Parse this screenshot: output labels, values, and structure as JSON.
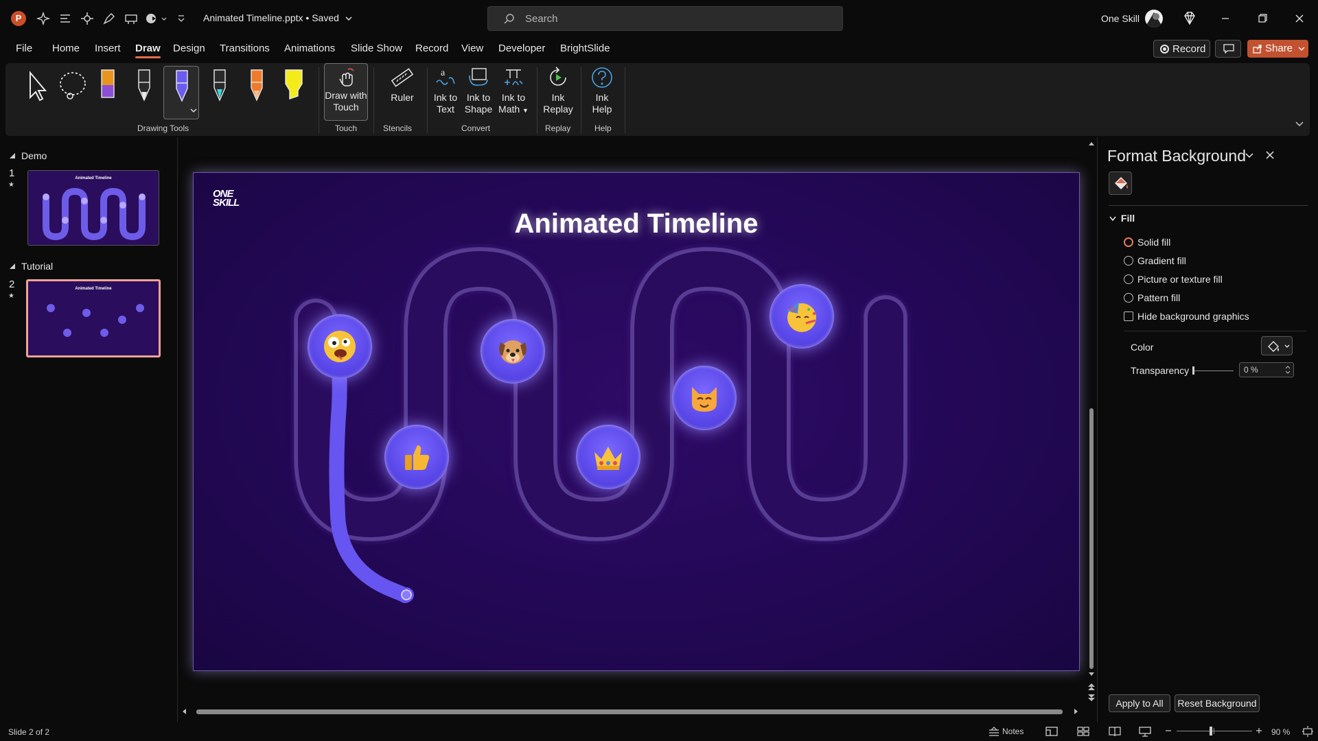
{
  "app": {
    "doc_title": "Animated Timeline.pptx • Saved",
    "search_placeholder": "Search",
    "user_name": "One Skill"
  },
  "tabs": [
    "File",
    "Home",
    "Insert",
    "Draw",
    "Design",
    "Transitions",
    "Animations",
    "Slide Show",
    "Record",
    "View",
    "Developer",
    "BrightSlide"
  ],
  "active_tab": "Draw",
  "top_buttons": {
    "record": "Record",
    "share": "Share"
  },
  "ribbon": {
    "groups": {
      "drawing_tools": "Drawing Tools",
      "touch": "Touch",
      "stencils": "Stencils",
      "convert": "Convert",
      "replay": "Replay",
      "help": "Help"
    },
    "buttons": {
      "draw_touch": [
        "Draw with",
        "Touch"
      ],
      "ruler": "Ruler",
      "ink_text": [
        "Ink to",
        "Text"
      ],
      "ink_shape": [
        "Ink to",
        "Shape"
      ],
      "ink_math": [
        "Ink to",
        "Math"
      ],
      "ink_replay": [
        "Ink",
        "Replay"
      ],
      "ink_help": [
        "Ink",
        "Help"
      ]
    }
  },
  "thumbnails": {
    "sections": [
      "Demo",
      "Tutorial"
    ],
    "slides": [
      {
        "num": "1",
        "title": "Animated Timeline"
      },
      {
        "num": "2",
        "title": "Animated Timeline"
      }
    ]
  },
  "slide": {
    "title": "Animated Timeline",
    "logo": [
      "ONE",
      "SKILL"
    ]
  },
  "pane": {
    "title": "Format Background",
    "section": "Fill",
    "options": [
      "Solid fill",
      "Gradient fill",
      "Picture or texture fill",
      "Pattern fill"
    ],
    "checkbox": "Hide background graphics",
    "color_label": "Color",
    "transparency_label": "Transparency",
    "transparency_value": "0 %",
    "apply_all": "Apply to All",
    "reset": "Reset Background"
  },
  "status": {
    "slide_info": "Slide 2 of 2",
    "notes": "Notes",
    "zoom": "90 %"
  },
  "colors": {
    "accent": "#e86a4a",
    "share": "#c2512f",
    "slide_bg": "#230856",
    "node": "#5a47e8",
    "ink": "#6655f0"
  }
}
